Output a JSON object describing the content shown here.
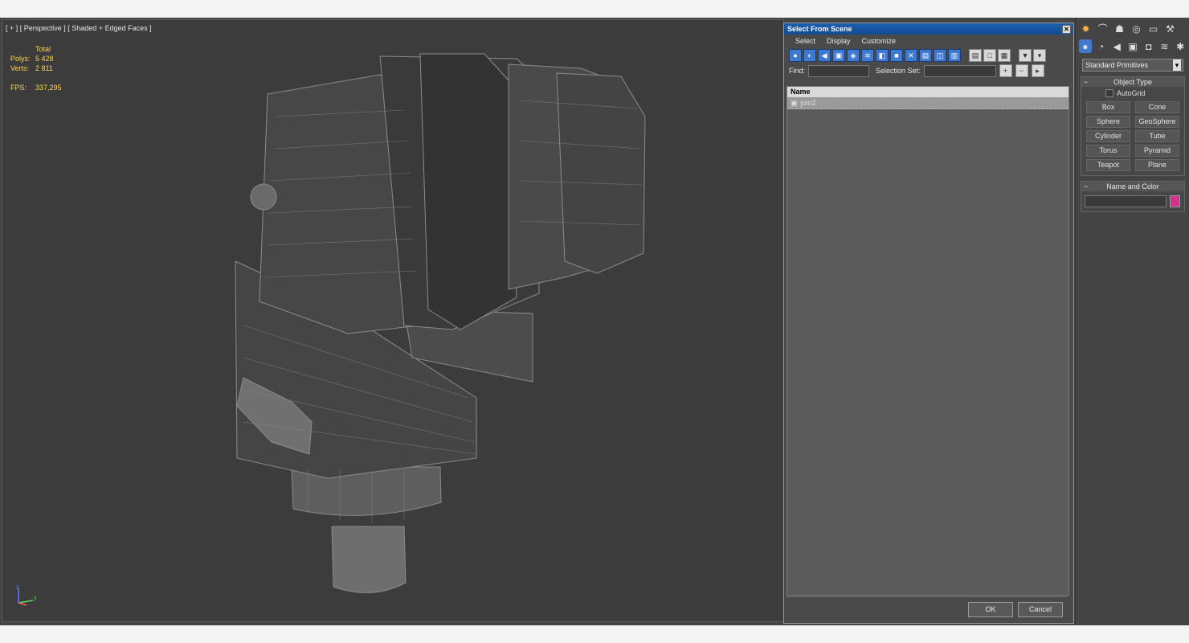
{
  "viewport": {
    "label": "[ + ] [ Perspective ] [ Shaded + Edged Faces ]",
    "stats": {
      "header": "Total",
      "polys_label": "Polys:",
      "polys": "5 428",
      "verts_label": "Verts:",
      "verts": "2 811",
      "fps_label": "FPS:",
      "fps": "337,295"
    },
    "axis": {
      "z": "z",
      "y": "y"
    }
  },
  "dialog": {
    "title": "Select From Scene",
    "close": "✕",
    "menu": [
      "Select",
      "Display",
      "Customize"
    ],
    "find_label": "Find:",
    "selection_set_label": "Selection Set:",
    "column_name": "Name",
    "items": [
      "join2"
    ],
    "ok": "OK",
    "cancel": "Cancel"
  },
  "panel": {
    "dropdown": "Standard Primitives",
    "object_type_title": "Object Type",
    "autogrid": "AutoGrid",
    "primitives": [
      "Box",
      "Cone",
      "Sphere",
      "GeoSphere",
      "Cylinder",
      "Tube",
      "Torus",
      "Pyramid",
      "Teapot",
      "Plane"
    ],
    "name_color_title": "Name and Color",
    "color_swatch": "#d0328c"
  }
}
